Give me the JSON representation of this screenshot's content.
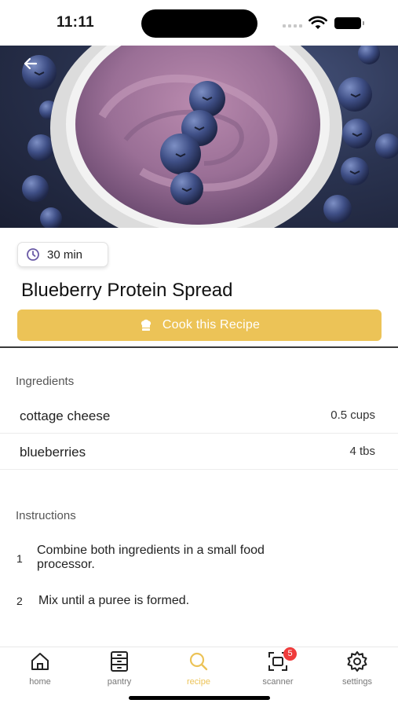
{
  "status_bar": {
    "time": "11:11"
  },
  "recipe": {
    "cook_time": "30 min",
    "title": "Blueberry Protein Spread",
    "cook_button_label": "Cook this Recipe"
  },
  "ingredients": {
    "heading": "Ingredients",
    "items": [
      {
        "name": "cottage cheese",
        "quantity": "0.5 cups"
      },
      {
        "name": "blueberries",
        "quantity": "4 tbs"
      }
    ]
  },
  "instructions": {
    "heading": "Instructions",
    "steps": [
      {
        "number": "1",
        "line1": "Combine both ingredients in a small food",
        "line2": "processor."
      },
      {
        "number": "2",
        "line1": "Mix until a puree is formed."
      }
    ]
  },
  "tabbar": {
    "tabs": [
      {
        "label": "home",
        "icon": "home-icon"
      },
      {
        "label": "pantry",
        "icon": "pantry-icon"
      },
      {
        "label": "recipe",
        "icon": "search-icon",
        "active": true
      },
      {
        "label": "scanner",
        "icon": "scanner-icon",
        "badge": "5"
      },
      {
        "label": "settings",
        "icon": "gear-icon"
      }
    ]
  },
  "colors": {
    "accent": "#ecc357",
    "badge": "#ef3b3b",
    "divider": "#3a3a3a"
  }
}
